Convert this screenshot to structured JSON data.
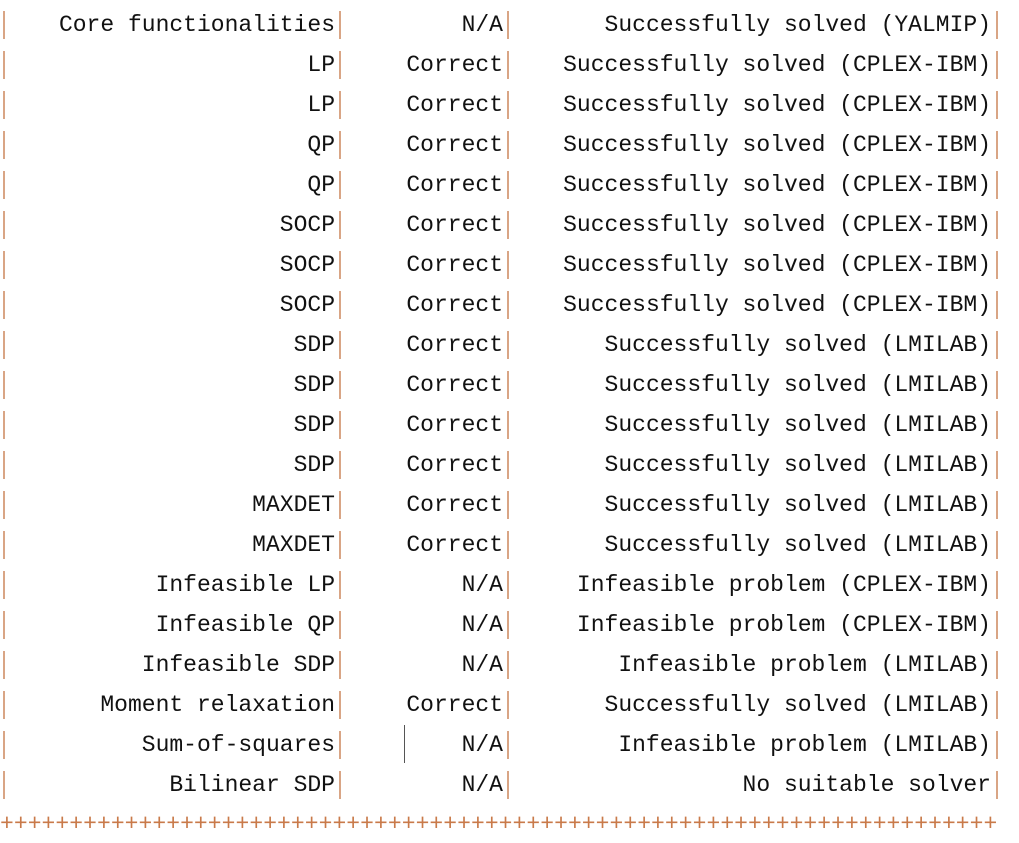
{
  "colors": {
    "separator": "#d9a585",
    "text": "#111111",
    "cursor": "#555555"
  },
  "rows": [
    {
      "test": "Core functionalities",
      "pass": "N/A",
      "info": "Successfully solved (YALMIP)"
    },
    {
      "test": "LP",
      "pass": "Correct",
      "info": "Successfully solved (CPLEX-IBM)"
    },
    {
      "test": "LP",
      "pass": "Correct",
      "info": "Successfully solved (CPLEX-IBM)"
    },
    {
      "test": "QP",
      "pass": "Correct",
      "info": "Successfully solved (CPLEX-IBM)"
    },
    {
      "test": "QP",
      "pass": "Correct",
      "info": "Successfully solved (CPLEX-IBM)"
    },
    {
      "test": "SOCP",
      "pass": "Correct",
      "info": "Successfully solved (CPLEX-IBM)"
    },
    {
      "test": "SOCP",
      "pass": "Correct",
      "info": "Successfully solved (CPLEX-IBM)"
    },
    {
      "test": "SOCP",
      "pass": "Correct",
      "info": "Successfully solved (CPLEX-IBM)"
    },
    {
      "test": "SDP",
      "pass": "Correct",
      "info": "Successfully solved (LMILAB)"
    },
    {
      "test": "SDP",
      "pass": "Correct",
      "info": "Successfully solved (LMILAB)"
    },
    {
      "test": "SDP",
      "pass": "Correct",
      "info": "Successfully solved (LMILAB)"
    },
    {
      "test": "SDP",
      "pass": "Correct",
      "info": "Successfully solved (LMILAB)"
    },
    {
      "test": "MAXDET",
      "pass": "Correct",
      "info": "Successfully solved (LMILAB)"
    },
    {
      "test": "MAXDET",
      "pass": "Correct",
      "info": "Successfully solved (LMILAB)"
    },
    {
      "test": "Infeasible LP",
      "pass": "N/A",
      "info": "Infeasible problem (CPLEX-IBM)"
    },
    {
      "test": "Infeasible QP",
      "pass": "N/A",
      "info": "Infeasible problem (CPLEX-IBM)"
    },
    {
      "test": "Infeasible SDP",
      "pass": "N/A",
      "info": "Infeasible problem (LMILAB)"
    },
    {
      "test": "Moment relaxation",
      "pass": "Correct",
      "info": "Successfully solved (LMILAB)"
    },
    {
      "test": "Sum-of-squares",
      "pass": "N/A",
      "info": "Infeasible problem (LMILAB)"
    },
    {
      "test": "Bilinear SDP",
      "pass": "N/A",
      "info": "No suitable solver"
    }
  ],
  "cursor_row": 18,
  "footer": "++++++++++++++++++++++++++++++++++++++++++++++++++++++++++++++++++++++++"
}
